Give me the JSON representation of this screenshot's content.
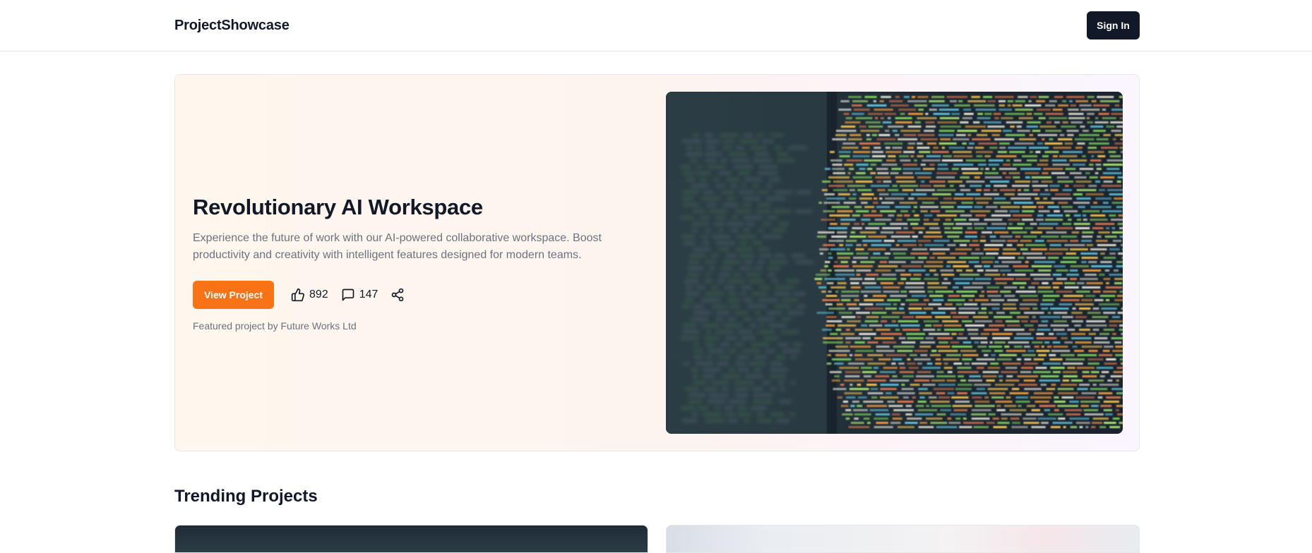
{
  "header": {
    "brand": "ProjectShowcase",
    "signin_label": "Sign In"
  },
  "hero": {
    "title": "Revolutionary AI Workspace",
    "description": "Experience the future of work with our AI-powered collaborative workspace. Boost productivity and creativity with intelligent features designed for modern teams.",
    "view_label": "View Project",
    "likes": "892",
    "comments": "147",
    "credit": "Featured project by Future Works Ltd",
    "image_icon": "code-screen-photo"
  },
  "trending": {
    "title": "Trending Projects"
  },
  "colors": {
    "accent": "#f97316",
    "dark": "#111827",
    "muted": "#6b7280"
  }
}
